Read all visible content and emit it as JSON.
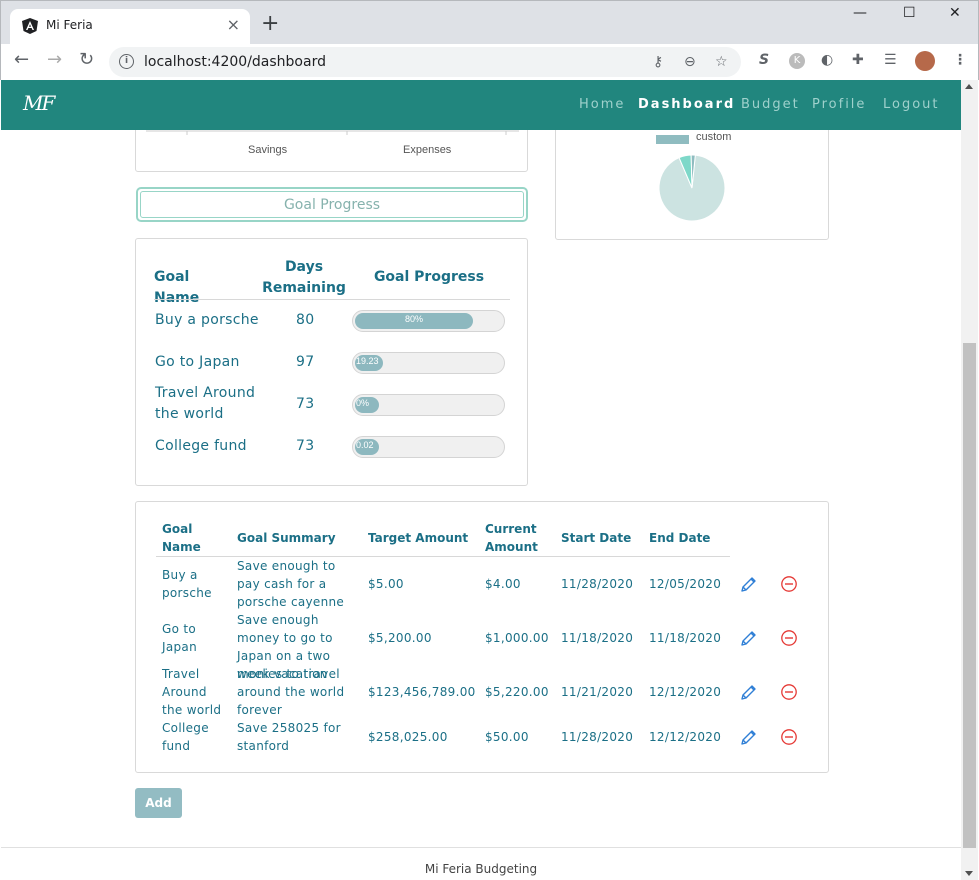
{
  "browser": {
    "tab_title": "Mi Feria",
    "url": "localhost:4200/dashboard",
    "window_controls": [
      "—",
      "☐",
      "✕"
    ],
    "new_tab": "+"
  },
  "nav": {
    "brand": "MF",
    "links": [
      "Home",
      "Dashboard",
      "Budget",
      "Profile",
      "Logout"
    ],
    "active": "Dashboard"
  },
  "chart_data": [
    {
      "type": "bar",
      "categories": [
        "Savings",
        "Expenses"
      ],
      "title": "",
      "xlabel": "",
      "ylabel": ""
    },
    {
      "type": "pie",
      "legend": [
        "custom"
      ],
      "slices": [
        {
          "value": 0.92,
          "color": "#cce3e1"
        },
        {
          "value": 0.06,
          "color": "#7ed8c9"
        },
        {
          "value": 0.02,
          "color": "#8fbcc0"
        }
      ]
    }
  ],
  "goal_progress_button": "Goal Progress",
  "progress_table": {
    "headers": [
      "Goal Name",
      "Days Remaining",
      "Goal Progress"
    ],
    "rows": [
      {
        "name": "Buy a porsche",
        "days": "80",
        "progress_label": "80%",
        "progress": 0.8
      },
      {
        "name": "Go to Japan",
        "days": "97",
        "progress_label": "19.23",
        "progress": 0.1923
      },
      {
        "name": "Travel Around the world",
        "days": "73",
        "progress_label": "0%",
        "progress": 0.0
      },
      {
        "name": "College fund",
        "days": "73",
        "progress_label": "0.02",
        "progress": 0.0002
      }
    ]
  },
  "goals_table": {
    "headers": [
      "Goal Name",
      "Goal Summary",
      "Target Amount",
      "Current Amount",
      "Start Date",
      "End Date"
    ],
    "rows": [
      {
        "name": "Buy a porsche",
        "summary": "Save enough to pay cash for a porsche cayenne",
        "target": "$5.00",
        "current": "$4.00",
        "start": "11/28/2020",
        "end": "12/05/2020"
      },
      {
        "name": "Go to Japan",
        "summary": "Save enough money to go to Japan on a two week vacation",
        "target": "$5,200.00",
        "current": "$1,000.00",
        "start": "11/18/2020",
        "end": "11/18/2020"
      },
      {
        "name": "Travel Around the world",
        "summary": "monies to travel around the world forever",
        "target": "$123,456,789.00",
        "current": "$5,220.00",
        "start": "11/21/2020",
        "end": "12/12/2020"
      },
      {
        "name": "College fund",
        "summary": "Save 258025 for stanford",
        "target": "$258,025.00",
        "current": "$50.00",
        "start": "11/28/2020",
        "end": "12/12/2020"
      }
    ],
    "row_icons": [
      "pencil-icon",
      "minus-circle-icon"
    ]
  },
  "add_button": "Add",
  "footer": "Mi Feria Budgeting",
  "colors": {
    "nav_bg": "#21867e",
    "text": "#1b6f86",
    "progress_fill": "#8db8bf",
    "outline": "#98d5c7",
    "delete_red": "#e53935",
    "edit_blue": "#2f7fd6"
  }
}
